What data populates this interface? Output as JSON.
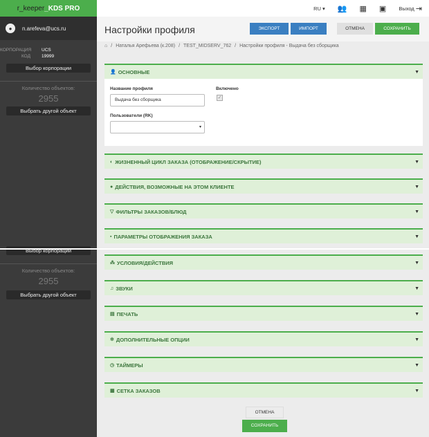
{
  "brand": {
    "part1": "r_keeper",
    "part2": "_KDS PRO"
  },
  "user": {
    "email": "n.arefeva@ucs.ru",
    "avatar_icon": "person-icon"
  },
  "corp": {
    "corp_label": "КОРПОРАЦИЯ",
    "corp_value": "UCS",
    "code_label": "КОД",
    "code_value": "19999",
    "choose_corp": "Выбор корпорации"
  },
  "objects": {
    "count_label": "Количество объектов:",
    "count": "2955",
    "choose_other": "Выбрать другой объект"
  },
  "topbar": {
    "lang": "RU",
    "users_icon": "users-icon",
    "qr_icon": "qrcode-icon",
    "calendar_icon": "calendar-icon",
    "exit": "Выход",
    "exit_icon": "logout-icon"
  },
  "header": {
    "title": "Настройки профиля",
    "export": "ЭКСПОРТ",
    "import": "ИМПОРТ",
    "cancel": "ОТМЕНА",
    "save": "СОХРАНИТЬ"
  },
  "breadcrumb": {
    "home_icon": "home-icon",
    "items": [
      "Наталья Арефьева (к.208)",
      "TEST_MIDSERV_762",
      "Настройки профиля - Выдача без сборщика"
    ]
  },
  "panels": {
    "basic": {
      "title": "ОСНОВНЫЕ",
      "icon": "person-icon",
      "profile_name_label": "Название профиля",
      "profile_name_value": "Выдача без сборщика",
      "enabled_label": "Включено",
      "users_label": "Пользователи (RK)",
      "users_value": ""
    },
    "lifecycle": {
      "title": "ЖИЗНЕННЫЙ ЦИКЛ ЗАКАЗА (ОТОБРАЖЕНИЕ/СКРЫТИЕ)",
      "icon": "lifecycle-icon"
    },
    "actions": {
      "title": "ДЕЙСТВИЯ, ВОЗМОЖНЫЕ НА ЭТОМ КЛИЕНТЕ",
      "icon": "actions-icon"
    },
    "filters": {
      "title": "ФИЛЬТРЫ ЗАКАЗОВ/БЛЮД",
      "icon": "filter-icon"
    },
    "display": {
      "title": "ПАРАМЕТРЫ ОТОБРАЖЕНИЯ ЗАКАЗА",
      "icon": "display-icon"
    },
    "conditions": {
      "title": "УСЛОВИЯ/ДЕЙСТВИЯ",
      "icon": "sitemap-icon"
    },
    "sounds": {
      "title": "ЗВУКИ",
      "icon": "music-icon"
    },
    "print": {
      "title": "ПЕЧАТЬ",
      "icon": "print-icon"
    },
    "options": {
      "title": "ДОПОЛНИТЕЛЬНЫЕ ОПЦИИ",
      "icon": "gear-icon"
    },
    "timers": {
      "title": "ТАЙМЕРЫ",
      "icon": "timer-icon"
    },
    "grid": {
      "title": "СЕТКА ЗАКАЗОВ",
      "icon": "grid-icon"
    }
  },
  "bottom": {
    "cancel": "ОТМЕНА",
    "save": "СОХРАНИТЬ"
  }
}
